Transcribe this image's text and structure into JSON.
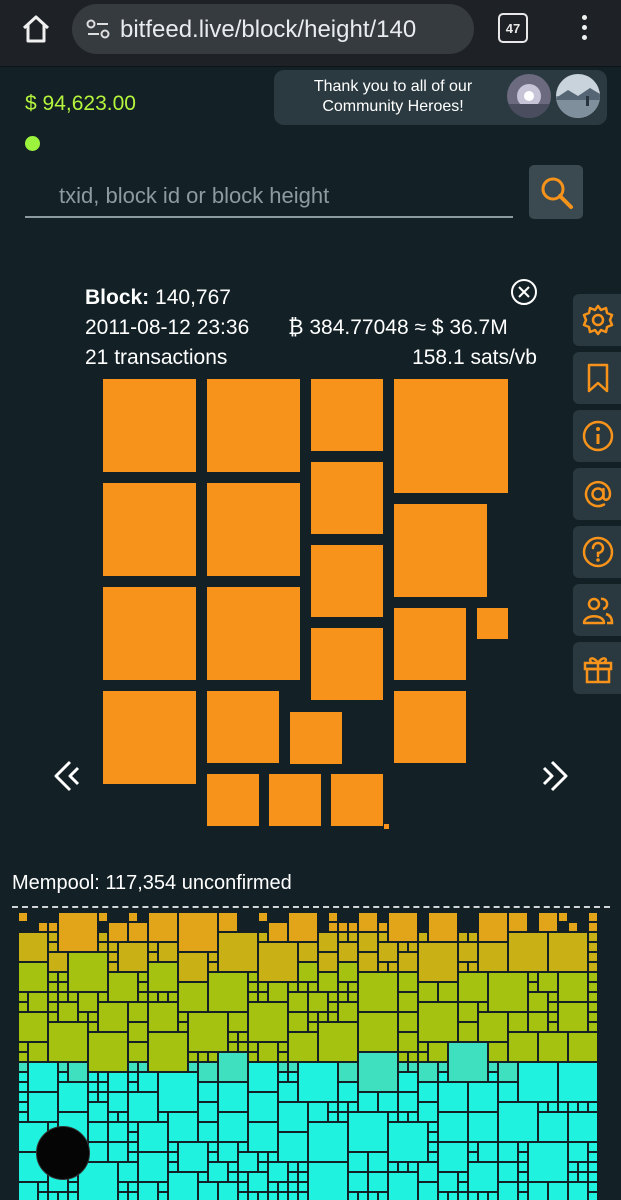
{
  "browser": {
    "url": "bitfeed.live/block/height/140",
    "tab_count": "47"
  },
  "header": {
    "price": "$ 94,623.00",
    "heroes_text": "Thank you to all of our Community Heroes!"
  },
  "search": {
    "placeholder": "txid, block id or block height"
  },
  "block": {
    "label": "Block:",
    "height": "140,767",
    "datetime": "2011-08-12 23:36",
    "value": "₿ 384.77048 ≈ $ 36.7M",
    "transactions": "21 transactions",
    "fee_rate": "158.1 sats/vb"
  },
  "side_menu": [
    "settings-icon",
    "bookmark-icon",
    "info-icon",
    "at-icon",
    "help-icon",
    "community-icon",
    "gift-icon"
  ],
  "mempool": {
    "label": "Mempool: 117,354 unconfirmed"
  },
  "colors": {
    "background": "#132126",
    "block_tx": "#f7931a",
    "price": "#b5f53c",
    "mempool_top": "#e2a51a",
    "mempool_mid": "#a6c210",
    "mempool_low": "#1ff3df"
  }
}
